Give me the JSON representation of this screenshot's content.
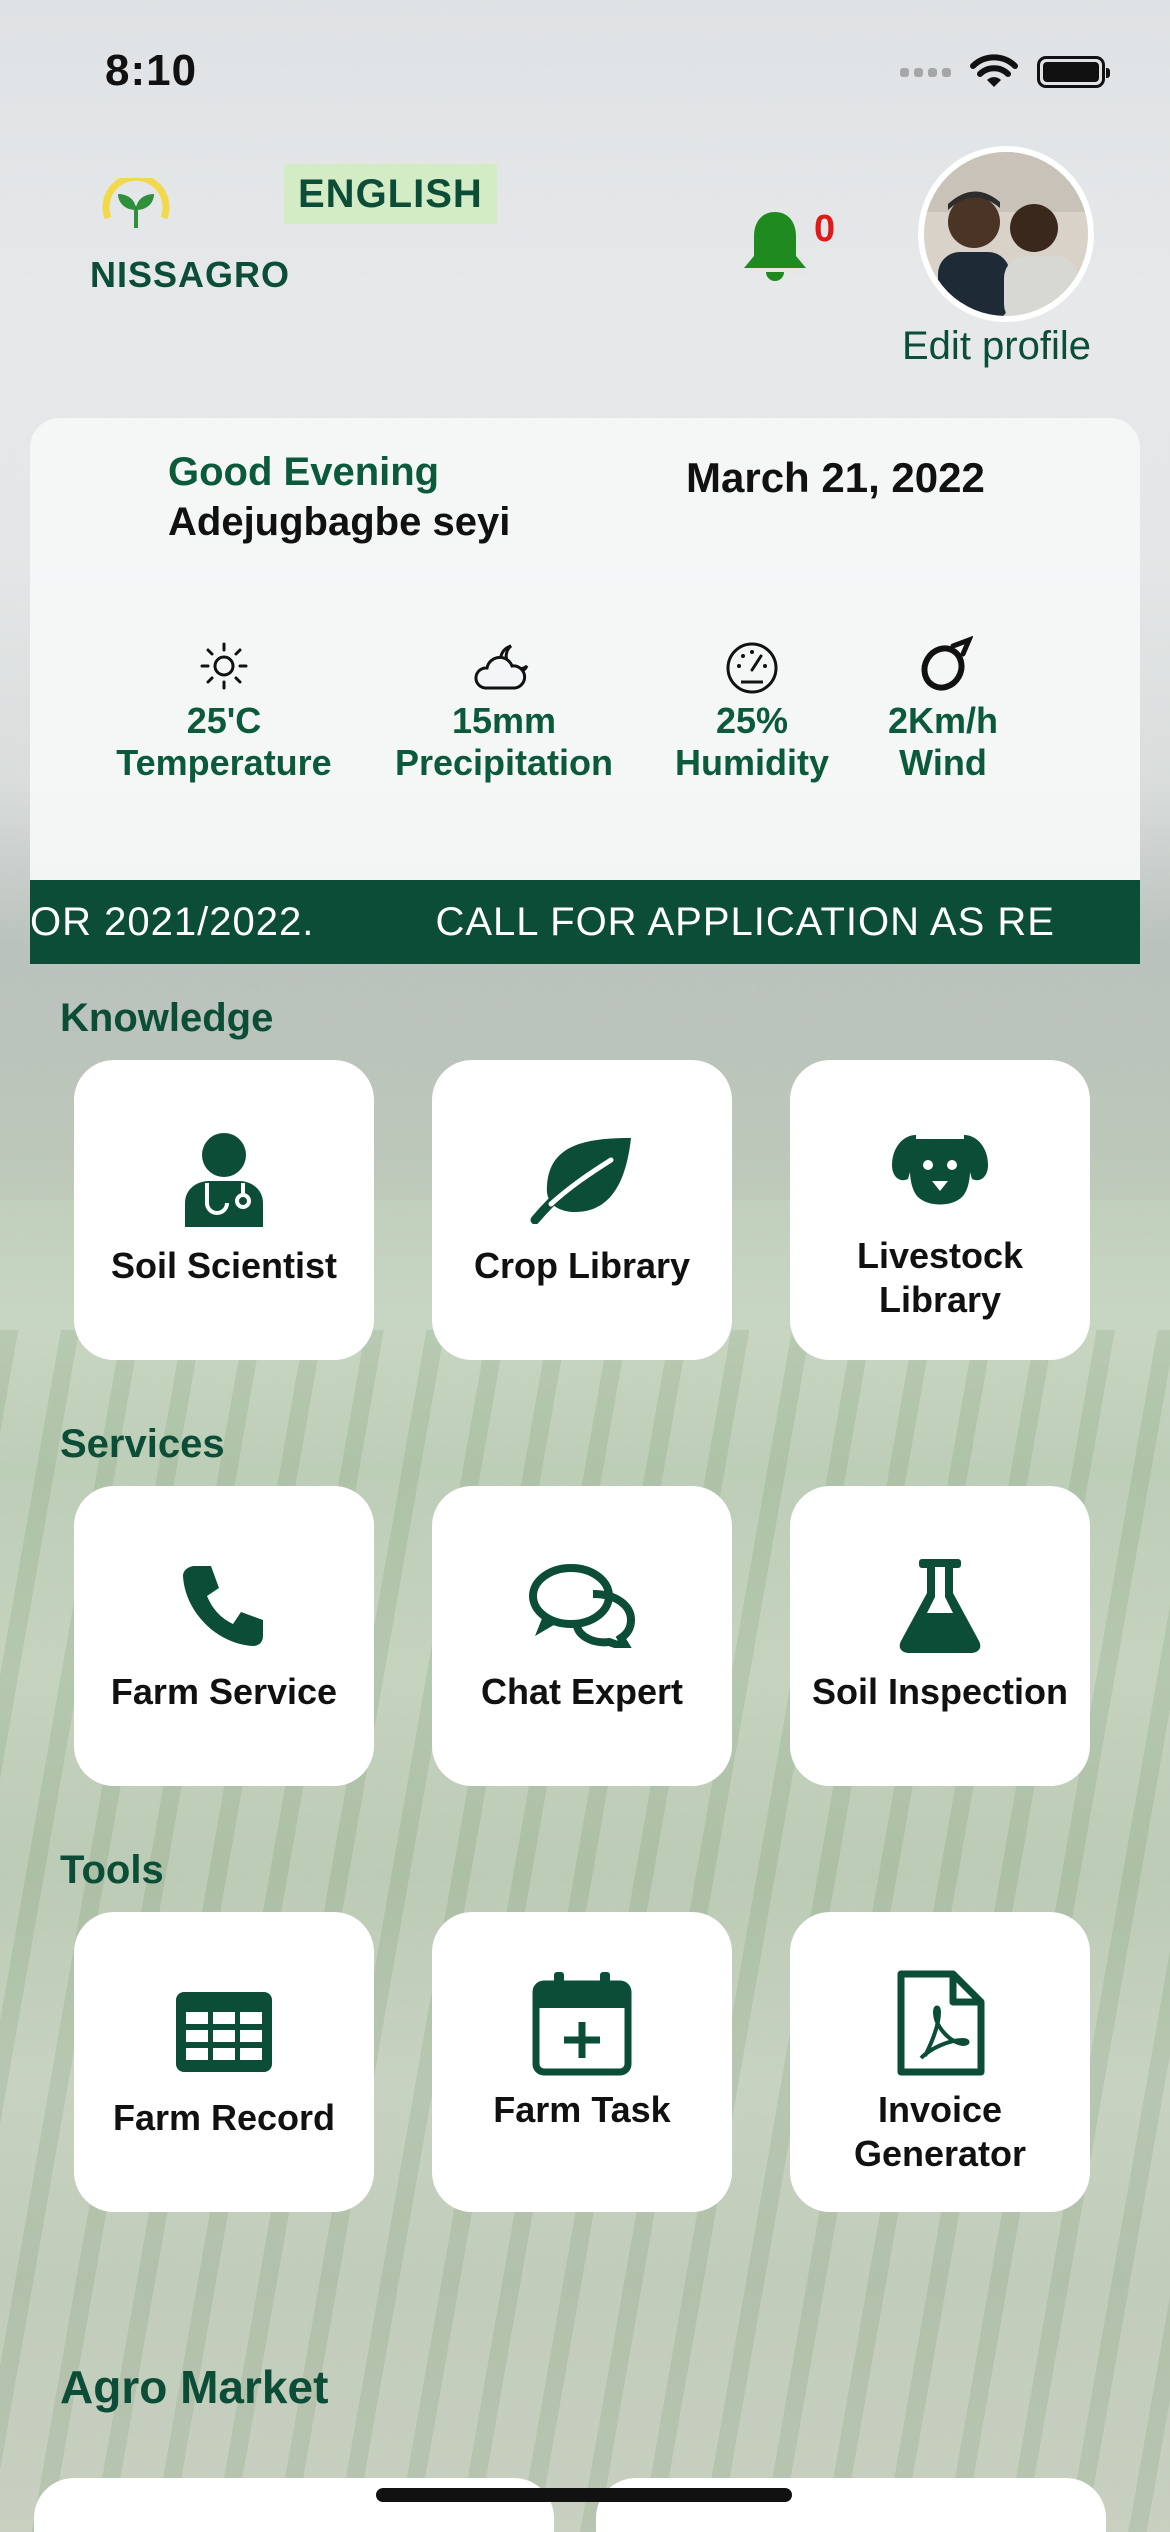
{
  "status_bar": {
    "time": "8:10"
  },
  "header": {
    "brand": "NISSAGRO",
    "language": "ENGLISH",
    "notification_count": "0",
    "edit_profile": "Edit profile"
  },
  "greeting": {
    "salutation": "Good Evening",
    "user_name": "Adejugbagbe seyi",
    "date": "March 21, 2022"
  },
  "weather": [
    {
      "icon": "sun-icon",
      "value": "25'C",
      "label": "Temperature"
    },
    {
      "icon": "cloud-moon-icon",
      "value": "15mm",
      "label": "Precipitation"
    },
    {
      "icon": "gauge-icon",
      "value": "25%",
      "label": "Humidity"
    },
    {
      "icon": "wind-icon",
      "value": "2Km/h",
      "label": "Wind"
    }
  ],
  "ticker": {
    "text": "OR 2021/2022.          CALL FOR APPLICATION AS RE"
  },
  "sections": {
    "knowledge": {
      "title": "Knowledge",
      "items": [
        {
          "label": "Soil Scientist",
          "icon": "doctor-icon"
        },
        {
          "label": "Crop Library",
          "icon": "leaf-icon"
        },
        {
          "label": "Livestock Library",
          "icon": "dog-icon"
        }
      ]
    },
    "services": {
      "title": "Services",
      "items": [
        {
          "label": "Farm Service",
          "icon": "phone-icon"
        },
        {
          "label": "Chat Expert",
          "icon": "chat-icon"
        },
        {
          "label": "Soil Inspection",
          "icon": "flask-icon"
        }
      ]
    },
    "tools": {
      "title": "Tools",
      "items": [
        {
          "label": "Farm Record",
          "icon": "table-icon"
        },
        {
          "label": "Farm Task",
          "icon": "calendar-plus-icon"
        },
        {
          "label": "Invoice Generator",
          "icon": "pdf-icon"
        }
      ]
    }
  },
  "agro_market": {
    "title": "Agro Market"
  },
  "colors": {
    "primary": "#0b4d36",
    "accent": "#d4ecc6",
    "badge": "#e01a1a",
    "bell": "#1f8a1f"
  }
}
